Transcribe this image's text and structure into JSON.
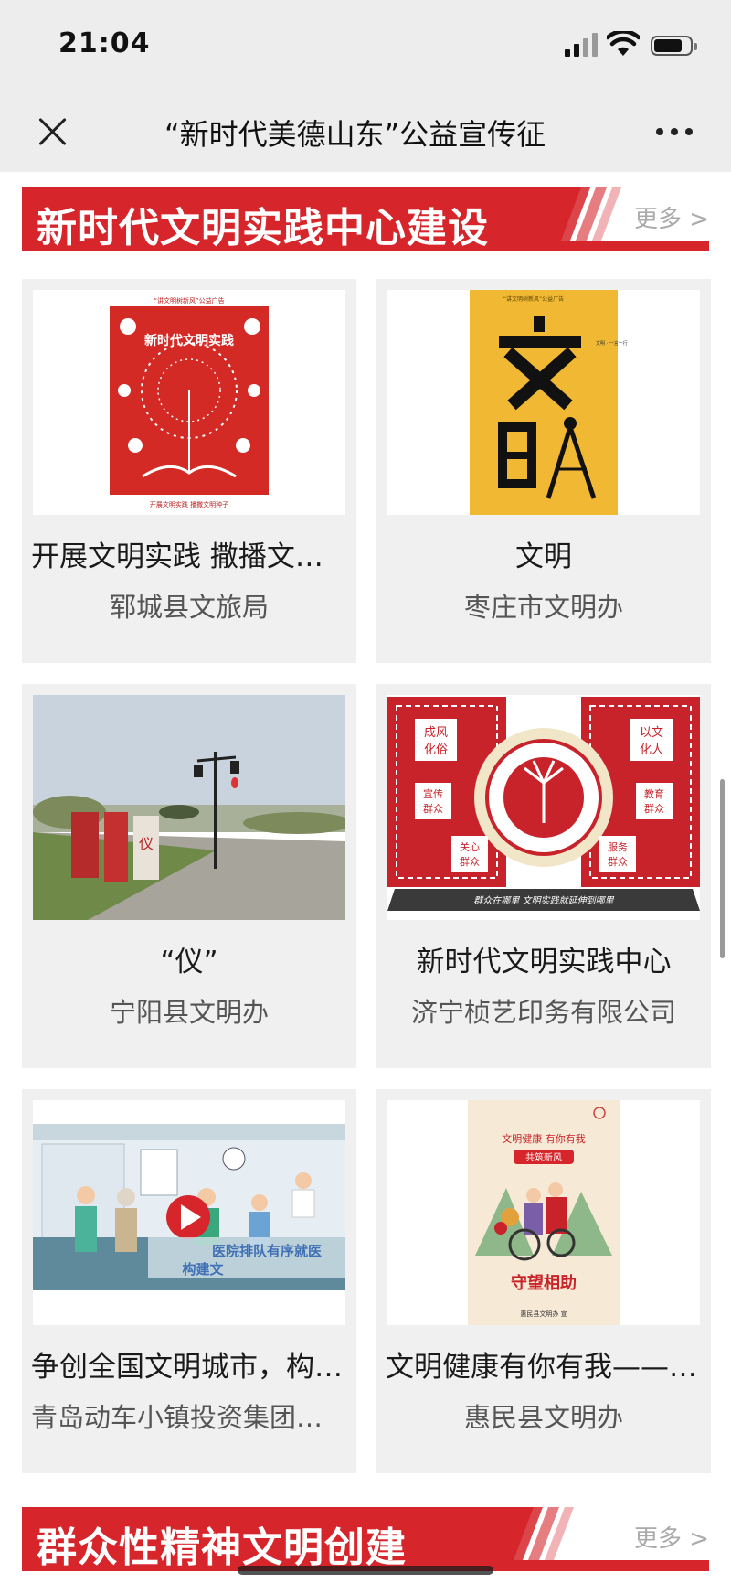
{
  "status": {
    "time": "21:04"
  },
  "nav": {
    "title": "“新时代美德山东”公益宣传征"
  },
  "sections": [
    {
      "title": "新时代文明实践中心建设",
      "more": "更多 >"
    },
    {
      "title": "群众性精神文明创建",
      "more": "更多 >"
    }
  ],
  "cards": [
    {
      "title": "开展文明实践 撒播文明种子",
      "source": "郓城县文旅局",
      "poster_caption": "开展文明实践  播撒文明种子",
      "poster_head": "新时代文明实践",
      "poster_top": "“讲文明树新风”公益广告"
    },
    {
      "title": "文明",
      "source": "枣庄市文明办",
      "poster_top": "“讲文明树新风”公益广告"
    },
    {
      "title": "“仪”",
      "source": "宁阳县文明办",
      "photo_sign": "仪"
    },
    {
      "title": "新时代文明实践中心",
      "source": "济宁桢艺印务有限公司",
      "panel_tl": "成风化俗",
      "panel_tr": "以文化人",
      "panel_ml": "宣传群众",
      "panel_mr": "教育群众",
      "panel_bl": "关心群众",
      "panel_br": "服务群众",
      "panel_bottom": "群众在哪里  文明实践就延伸到哪里"
    },
    {
      "title": "争创全国文明城市，构建文明社会",
      "source": "青岛动车小镇投资集团有限公司",
      "caption": "医院排队有序就医",
      "caption2": "构建文"
    },
    {
      "title": "文明健康有你有我——守望相助",
      "source": "惠民县文明办",
      "head": "文明健康  有你有我",
      "badge": "共筑新风",
      "foot": "守望相助",
      "small": "惠民县文明办  宣"
    }
  ],
  "colors": {
    "brand_red": "#d6262b",
    "nav_bg": "#ededed",
    "card_bg": "#f0f0f0"
  }
}
